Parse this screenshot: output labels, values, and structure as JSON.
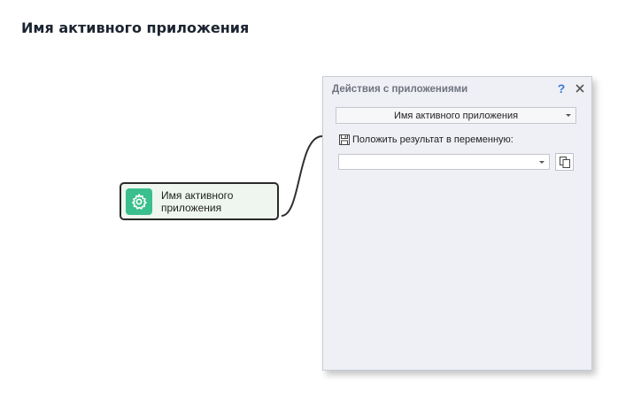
{
  "page": {
    "title": "Имя активного приложения"
  },
  "node": {
    "label": "Имя активного приложения",
    "icon": "gear-icon",
    "accent_color": "#3bbf8e"
  },
  "panel": {
    "title": "Действия с приложениями",
    "help_label": "?",
    "action_select": {
      "selected": "Имя активного приложения"
    },
    "result": {
      "label": "Положить результат в переменную:",
      "icon": "save-icon",
      "value": ""
    },
    "copy_icon": "copy-icon"
  }
}
